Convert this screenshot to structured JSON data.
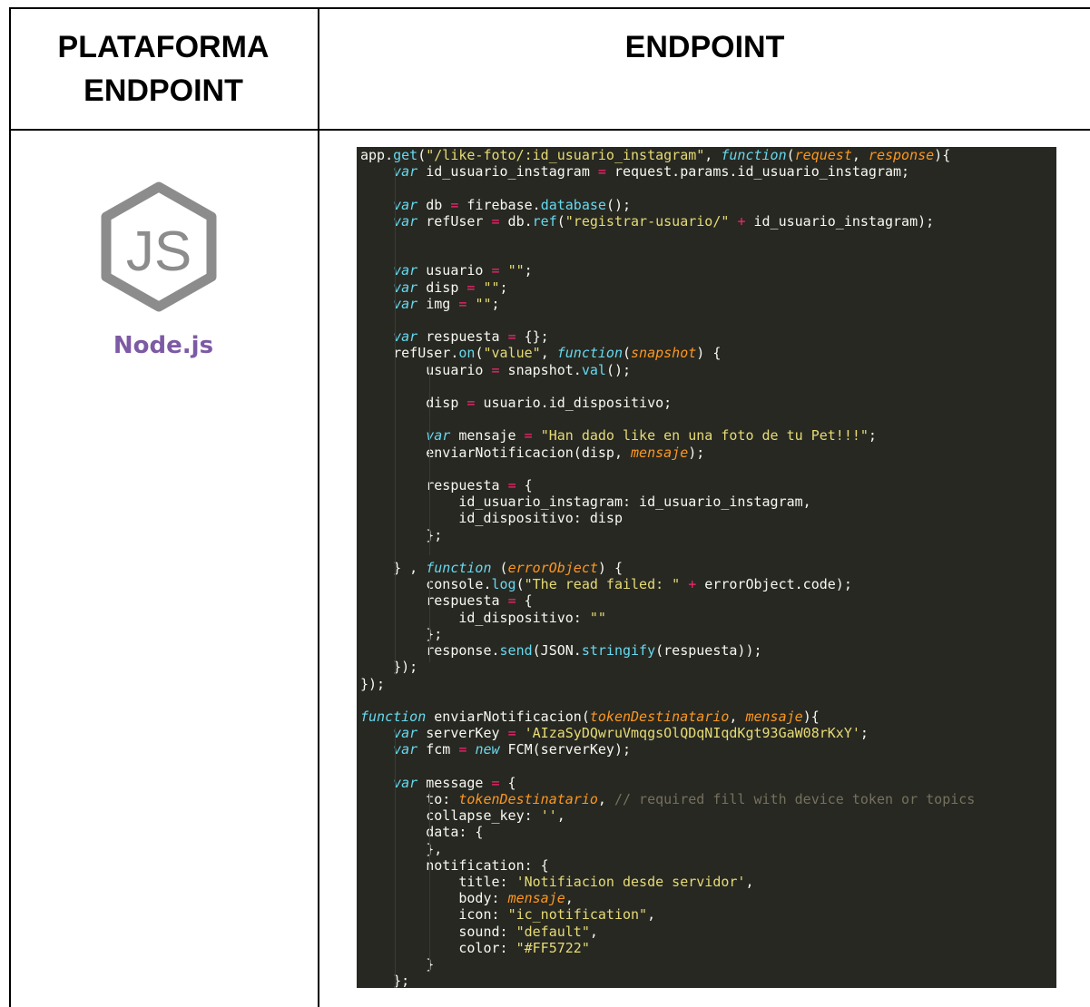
{
  "table": {
    "header_left_line1": "PLATAFORMA",
    "header_left_line2": "ENDPOINT",
    "header_right": "ENDPOINT"
  },
  "logo": {
    "icon": "nodejs-hexagon-icon",
    "label": "Node.js",
    "colors": {
      "hexagon": "#8c8c8c",
      "label": "#7d5aa4"
    }
  },
  "code_editor": {
    "theme_colors": {
      "background": "#272822",
      "text": "#f8f8f2",
      "keyword": "#66d9ef",
      "string": "#e6db74",
      "operator": "#f92672",
      "param": "#fd971f",
      "comment": "#75715e"
    },
    "lines": [
      "app.get(\"/like-foto/:id_usuario_instagram\", function(request, response){",
      "    var id_usuario_instagram = request.params.id_usuario_instagram;",
      "",
      "    var db = firebase.database();",
      "    var refUser = db.ref(\"registrar-usuario/\" + id_usuario_instagram);",
      "",
      "",
      "    var usuario = \"\";",
      "    var disp = \"\";",
      "    var img = \"\";",
      "",
      "    var respuesta = {};",
      "    refUser.on(\"value\", function(snapshot) {",
      "        usuario = snapshot.val();",
      "",
      "        disp = usuario.id_dispositivo;",
      "",
      "        var mensaje = \"Han dado like en una foto de tu Pet!!!\";",
      "        enviarNotificacion(disp, mensaje);",
      "",
      "        respuesta = {",
      "            id_usuario_instagram: id_usuario_instagram,",
      "            id_dispositivo: disp",
      "        };",
      "",
      "    } , function (errorObject) {",
      "        console.log(\"The read failed: \" + errorObject.code);",
      "        respuesta = {",
      "            id_dispositivo: \"\"",
      "        };",
      "        response.send(JSON.stringify(respuesta));",
      "    });",
      "});",
      "",
      "function enviarNotificacion(tokenDestinatario, mensaje){",
      "    var serverKey = 'AIzaSyDQwruVmqgsOlQDqNIqdKgt93GaW08rKxY';",
      "    var fcm = new FCM(serverKey);",
      "",
      "    var message = {",
      "        to: tokenDestinatario, // required fill with device token or topics",
      "        collapse_key: '',",
      "        data: {",
      "        },",
      "        notification: {",
      "            title: 'Notifiacion desde servidor',",
      "            body: mensaje,",
      "            icon: \"ic_notification\",",
      "            sound: \"default\",",
      "            color: \"#FF5722\"",
      "        }",
      "    };"
    ]
  }
}
